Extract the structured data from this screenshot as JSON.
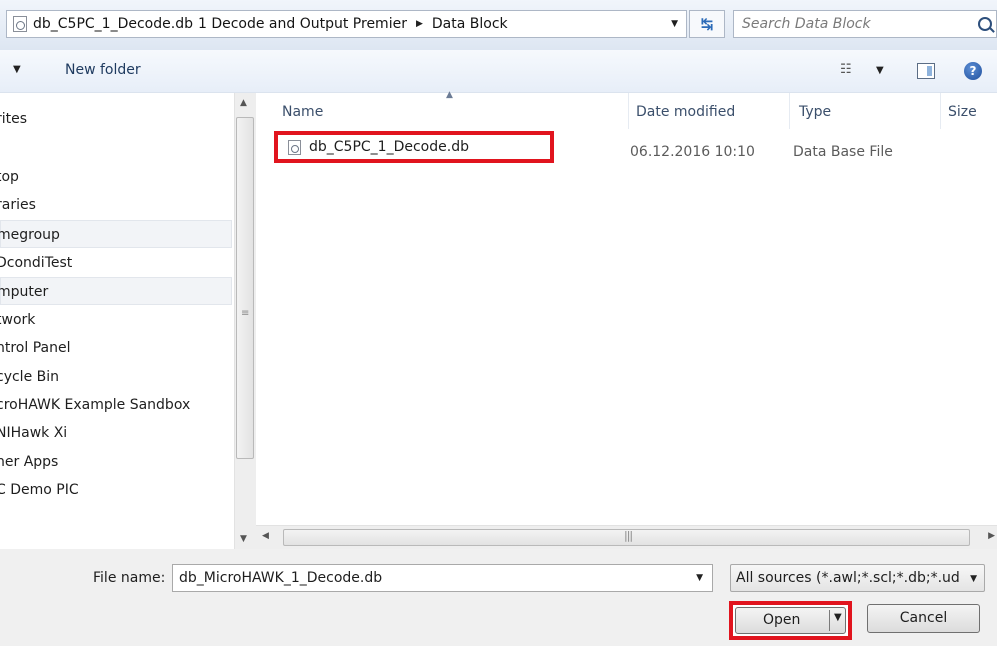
{
  "address_bar": {
    "segments": [
      "db_C5PC_1_Decode.db",
      "1 Decode and Output Premier",
      "Data Block"
    ],
    "search_placeholder": "Search Data Block"
  },
  "toolbar": {
    "new_folder_label": "New folder"
  },
  "nav": {
    "items": [
      {
        "label": "rites",
        "highlighted": false
      },
      {
        "label": "",
        "highlighted": false
      },
      {
        "label": "top",
        "highlighted": false
      },
      {
        "label": "raries",
        "highlighted": false
      },
      {
        "label": "megroup",
        "highlighted": true
      },
      {
        "label": "DcondiTest",
        "highlighted": false
      },
      {
        "label": "mputer",
        "highlighted": true
      },
      {
        "label": "twork",
        "highlighted": false
      },
      {
        "label": "ntrol Panel",
        "highlighted": false
      },
      {
        "label": "cycle Bin",
        "highlighted": false
      },
      {
        "label": "croHAWK Example Sandbox",
        "highlighted": false
      },
      {
        "label": "NIHawk Xi",
        "highlighted": false
      },
      {
        "label": "her Apps",
        "highlighted": false
      },
      {
        "label": "C Demo PIC",
        "highlighted": false
      }
    ]
  },
  "file_list": {
    "columns": {
      "name": "Name",
      "date_modified": "Date modified",
      "type": "Type",
      "size": "Size"
    },
    "rows": [
      {
        "name": "db_C5PC_1_Decode.db",
        "date_modified": "06.12.2016 10:10",
        "type": "Data Base File"
      }
    ]
  },
  "bottom": {
    "file_name_label": "File name:",
    "file_name_value": "db_MicroHAWK_1_Decode.db",
    "filter_value": "All sources (*.awl;*.scl;*.db;*.ud",
    "open_label": "Open",
    "cancel_label": "Cancel"
  },
  "colors": {
    "highlight_box": "#e1141e",
    "address_bg": "#dde6f2",
    "bottom_bg": "#f0f0f0"
  }
}
